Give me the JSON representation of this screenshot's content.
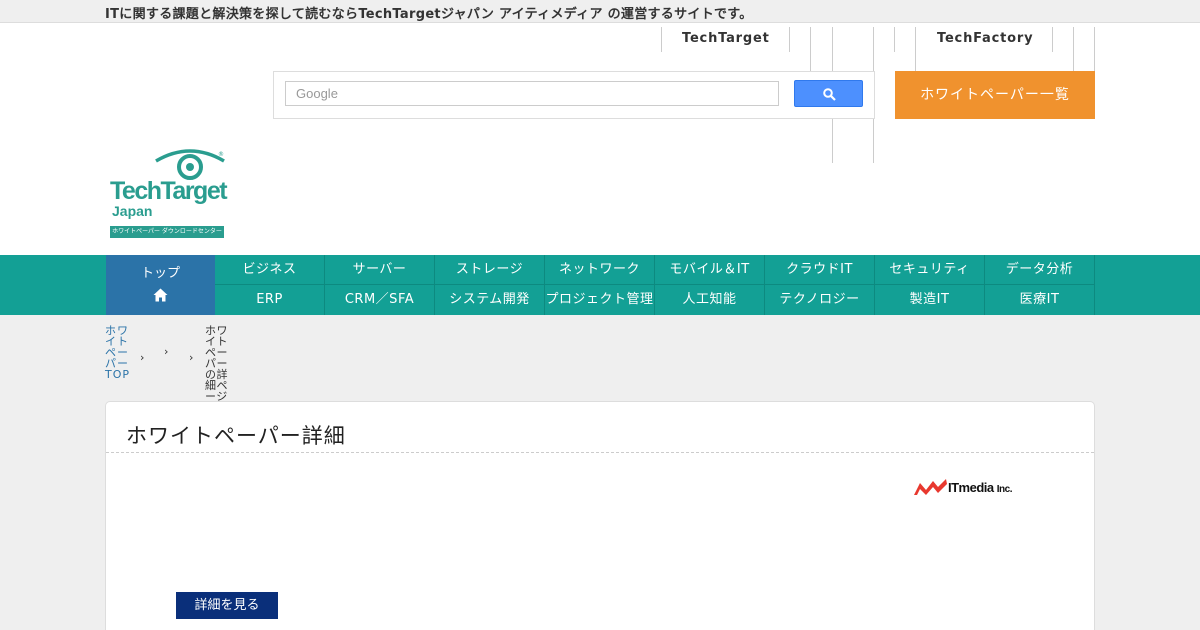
{
  "topbar": {
    "text": "ITに関する課題と解決策を探して読むならTechTargetジャパン アイティメディア の運営するサイトです。"
  },
  "header": {
    "links": [
      "TechTarget",
      "TechFactory"
    ],
    "search": {
      "placeholder": "Google",
      "button_icon": "search-icon"
    },
    "action_button": "ホワイトペーパー一覧"
  },
  "logo": {
    "brand": "TechTarget",
    "sub": "Japan",
    "tagline": "ホワイトペーパー ダウンロードセンター"
  },
  "nav": {
    "home_label": "トップ",
    "row1": [
      "ビジネス",
      "サーバー",
      "ストレージ",
      "ネットワーク",
      "モバイル＆IT",
      "クラウドIT",
      "セキュリティ",
      "データ分析"
    ],
    "row2": [
      "ERP",
      "CRM／SFA",
      "システム開発",
      "プロジェクト管理",
      "人工知能",
      "テクノロジー",
      "製造IT",
      "医療IT"
    ]
  },
  "breadcrumb": {
    "home": "ホワイトペーパーTOP",
    "current": "ホワイトペーパーの詳細ページ"
  },
  "card": {
    "title": "ホワイトペーパー詳細",
    "company": "ITmedia",
    "company_suffix": "Inc.",
    "button": "詳細を見る"
  },
  "colors": {
    "nav": "#13a095",
    "home": "#2b73a8",
    "orange": "#f0922e",
    "navy": "#0a2f7a",
    "brand": "#2a9d8f",
    "itmedia": "#e8382e"
  }
}
